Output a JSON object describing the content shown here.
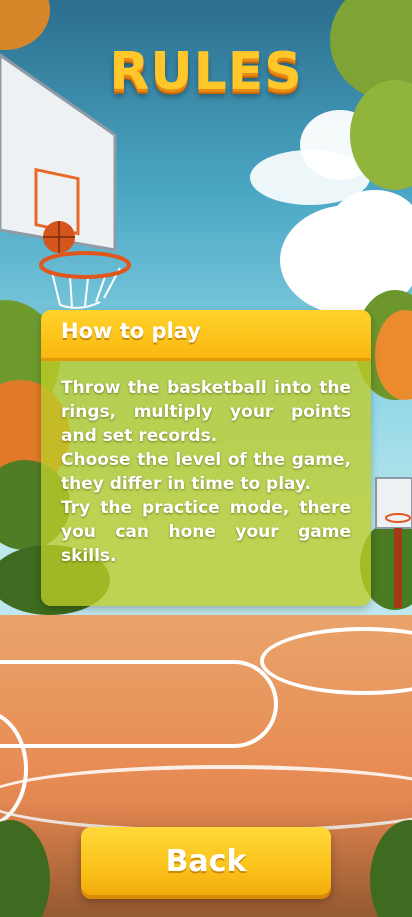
{
  "screen": {
    "title": "RULES"
  },
  "panel": {
    "header": "How to play",
    "paragraphs": [
      "Throw the basketball into the rings, multiply your points and set records.",
      "Choose the level of the game, they differ in time to play.",
      "Try the practice mode, there you can hone your game skills."
    ]
  },
  "buttons": {
    "back": "Back"
  },
  "colors": {
    "title": "#ffc72a",
    "panel_header": "#f9b80f",
    "button": "#fbc21b",
    "panel_body": "#bccd28"
  },
  "icons": [
    "basketball-hoop-illustration",
    "basketball-illustration"
  ]
}
